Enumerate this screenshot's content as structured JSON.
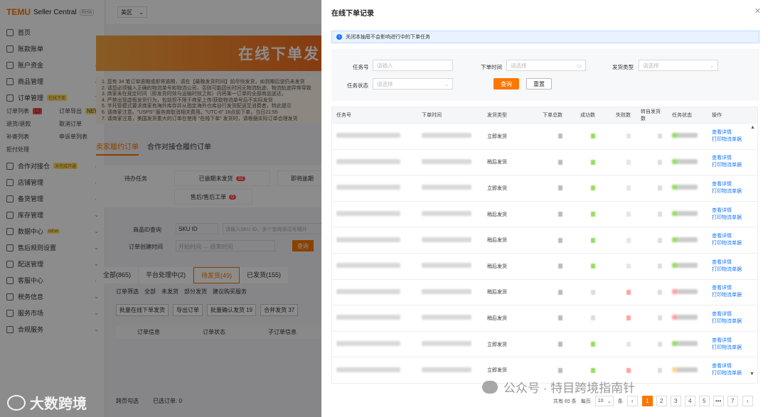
{
  "brand": {
    "logo": "TEMU",
    "title": "Seller Central",
    "beta": "Beta"
  },
  "sidebar": {
    "items": [
      {
        "label": "首页"
      },
      {
        "label": "账款账单"
      },
      {
        "label": "账户资金"
      },
      {
        "label": "商品管理"
      },
      {
        "label": "订单管理",
        "badge": "在线下单"
      }
    ],
    "sub": [
      {
        "label": "订单列表",
        "count": "13"
      },
      {
        "label": "订单导出",
        "badge": "NEW"
      },
      {
        "label": "退货/退款"
      },
      {
        "label": "取消订单"
      },
      {
        "label": "补寄列表"
      },
      {
        "label": "申诉单列表"
      },
      {
        "label": "拒付处理"
      }
    ],
    "items2": [
      {
        "label": "合作对接仓",
        "badge": "未完成开通"
      },
      {
        "label": "店铺管理"
      },
      {
        "label": "备货管理"
      },
      {
        "label": "库存管理"
      },
      {
        "label": "数据中心",
        "badge": "NEW"
      },
      {
        "label": "售后规则设置"
      },
      {
        "label": "配送管理"
      },
      {
        "label": "客服中心"
      },
      {
        "label": "税务信息"
      },
      {
        "label": "服务市场"
      },
      {
        "label": "合规服务"
      }
    ]
  },
  "background": {
    "region": "美区",
    "banner": "在线下单发",
    "notice": "1. 您有 34 笔订单逾期或即将逾期，请在【最晚发货时间】前尽快发货，如到期后逆仍未发货\n2. 请您必须输入正确的物流单号和物流公司，否则可能因长时间无物流轨迹、物流轨迹异常导致\n3. 商家未在规定时间（即发货时效与运输时效之和）内将某一订单的全部商品送达，\n4. 严禁出现虚假发货行为，包括但不限于商家上传/获取物流单号后不实际发货\n5. 半托管模式要求商家有海外库存并从指定海外仓库自行发货配送至消费者，特此提示\n6. 请商家注意。\"USPS\" 服务商取消相关费用。\"UTC-6\" 18点前下单，当日21:55\n7. 请商家注意，美国发货重大的订单在使用 \"在线下单\" 发货时，请根据实际订单合理发货",
    "tabs": [
      "卖家履约订单",
      "合作对接仓履约订单"
    ],
    "todo_label": "待办任务",
    "todo": [
      {
        "label": "已逾期未发货",
        "count": "32"
      },
      {
        "label": "即将逾期"
      },
      {
        "label": "售后/售后工单",
        "count": "0"
      }
    ],
    "filter_label1": "商品ID查询",
    "filter_select1": "SKU ID",
    "filter_ph1": "请输入SKU ID，多个查询请逗号隔开",
    "filter_label2": "订单创建时间",
    "filter_date2": "开始时间 → 结束时间",
    "filter_btn": "查询",
    "status_tabs": [
      "全部(865)",
      "平台处理中(2)",
      "待发货(49)",
      "已发货(155)"
    ],
    "order_filter": "订单筛选",
    "order_radio": [
      "全部",
      "未发货",
      "部分发货",
      "建议购买服务"
    ],
    "actions": [
      "批量在线下单发货",
      "导出订单",
      "批量确认发货 19",
      "合并发货 37"
    ],
    "col_headers": [
      "订单信息",
      "订单状态",
      "子订单信息"
    ],
    "footer": [
      "跨页勾选",
      "已选订单: 0"
    ]
  },
  "watermark": {
    "left": "大数跨境",
    "right": "公众号 · 特目跨境指南针"
  },
  "modal": {
    "title": "在线下单记录",
    "alert": "关闭本抽屉不会影响进行中的下单任务",
    "filters": {
      "task_no": "任务号",
      "task_no_ph": "请输入",
      "order_time": "下单时间",
      "order_time_ph": "请选择",
      "ship_type": "发货类型",
      "ship_type_ph": "请选择",
      "task_status": "任务状态",
      "task_status_ph": "请选择",
      "query": "查询",
      "reset": "重置"
    },
    "columns": [
      "任务号",
      "下单时间",
      "发货类型",
      "下单总数",
      "成功数",
      "失败数",
      "转自发货数",
      "任务状态",
      "操作"
    ],
    "rows": [
      {
        "type": "立即发货",
        "s": "g",
        "f": "",
        "st": "g"
      },
      {
        "type": "稍后发货",
        "s": "g",
        "f": "",
        "st": "g"
      },
      {
        "type": "立即发货",
        "s": "g",
        "f": "",
        "st": "g"
      },
      {
        "type": "稍后发货",
        "s": "g",
        "f": "",
        "st": "g"
      },
      {
        "type": "稍后发货",
        "s": "g",
        "f": "",
        "st": "g"
      },
      {
        "type": "稍后发货",
        "s": "g",
        "f": "",
        "st": "g"
      },
      {
        "type": "稍后发货",
        "s": "",
        "f": "r",
        "st": "r"
      },
      {
        "type": "稍后发货",
        "s": "",
        "f": "r",
        "st": "r"
      },
      {
        "type": "立即发货",
        "s": "g",
        "f": "",
        "st": "g"
      },
      {
        "type": "立即发货",
        "s": "g",
        "f": "r",
        "st": "o"
      }
    ],
    "link_view": "查看详情",
    "link_print": "打印物流单据",
    "pager": {
      "total": "共有 65 条",
      "per_page_label": "每页",
      "per_page": "10",
      "unit": "条",
      "pages": [
        "1",
        "2",
        "3",
        "4",
        "5",
        "•••",
        "7"
      ]
    }
  },
  "colors": {
    "accent": "#fb7701",
    "link": "#1677ff",
    "success": "#52c41a",
    "fail": "#ff7875"
  }
}
